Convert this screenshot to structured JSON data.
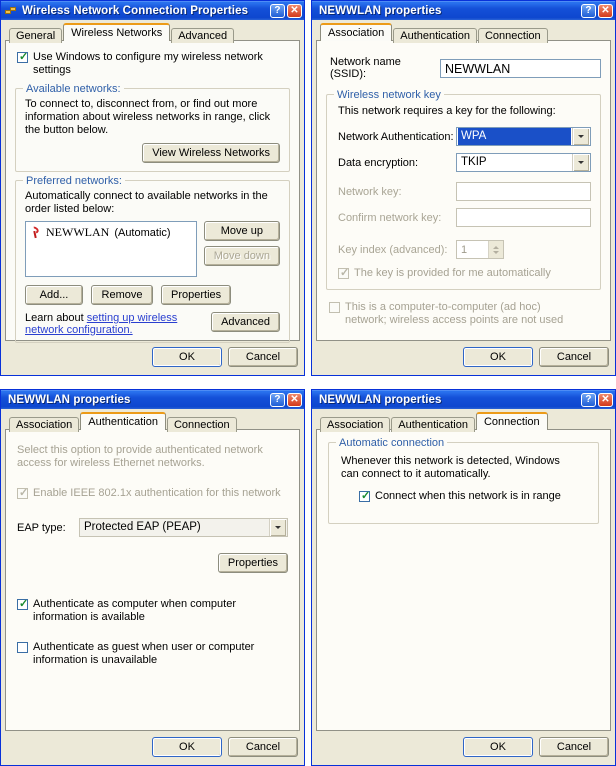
{
  "windows": {
    "wncp": {
      "title": "Wireless Network Connection Properties",
      "help_label": "?",
      "close_label": "✕",
      "tabs": [
        {
          "label": "General",
          "active": false
        },
        {
          "label": "Wireless Networks",
          "active": true
        },
        {
          "label": "Advanced",
          "active": false
        }
      ],
      "use_windows_checkbox": "Use Windows to configure my wireless network settings",
      "available_group": {
        "legend": "Available networks:",
        "description": "To connect to, disconnect from, or find out more information about wireless networks in range, click the button below.",
        "view_button": "View Wireless Networks"
      },
      "preferred_group": {
        "legend": "Preferred networks:",
        "description": "Automatically connect to available networks in the order listed below:",
        "list": [
          {
            "name": "NEWWLAN",
            "mode": "(Automatic)",
            "icon": "wireless-signal-icon"
          }
        ],
        "move_up": "Move up",
        "move_down": "Move down",
        "add": "Add...",
        "remove": "Remove",
        "properties": "Properties",
        "learn_prefix": "Learn about ",
        "learn_link": "setting up wireless network configuration.",
        "advanced": "Advanced"
      },
      "ok": "OK",
      "cancel": "Cancel"
    },
    "assoc": {
      "title": "NEWWLAN properties",
      "help_label": "?",
      "close_label": "✕",
      "tabs": [
        {
          "label": "Association",
          "active": true
        },
        {
          "label": "Authentication",
          "active": false
        },
        {
          "label": "Connection",
          "active": false
        }
      ],
      "ssid_label": "Network name (SSID):",
      "ssid_value": "NEWWLAN",
      "key_group": {
        "legend": "Wireless network key",
        "description": "This network requires a key for the following:",
        "auth_label": "Network Authentication:",
        "auth_value": "WPA",
        "enc_label": "Data encryption:",
        "enc_value": "TKIP",
        "netkey_label": "Network key:",
        "netkey_value": "",
        "confirm_label": "Confirm network key:",
        "confirm_value": "",
        "keyindex_label": "Key index (advanced):",
        "keyindex_value": "1",
        "auto_key_checkbox": "The key is provided for me automatically"
      },
      "adhoc_checkbox": "This is a computer-to-computer (ad hoc) network; wireless access points are not used",
      "ok": "OK",
      "cancel": "Cancel"
    },
    "auth": {
      "title": "NEWWLAN properties",
      "help_label": "?",
      "close_label": "✕",
      "tabs": [
        {
          "label": "Association",
          "active": false
        },
        {
          "label": "Authentication",
          "active": true
        },
        {
          "label": "Connection",
          "active": false
        }
      ],
      "description": "Select this option to provide authenticated network access for wireless Ethernet networks.",
      "enable_8021x_checkbox": "Enable IEEE 802.1x authentication for this network",
      "eap_label": "EAP type:",
      "eap_value": "Protected EAP (PEAP)",
      "properties": "Properties",
      "auth_computer_checkbox": "Authenticate as computer when computer information is available",
      "auth_guest_checkbox": "Authenticate as guest when user or computer information is unavailable",
      "ok": "OK",
      "cancel": "Cancel"
    },
    "conn": {
      "title": "NEWWLAN properties",
      "help_label": "?",
      "close_label": "✕",
      "tabs": [
        {
          "label": "Association",
          "active": false
        },
        {
          "label": "Authentication",
          "active": false
        },
        {
          "label": "Connection",
          "active": true
        }
      ],
      "group": {
        "legend": "Automatic connection",
        "description": "Whenever this network is detected, Windows can connect to it automatically.",
        "connect_checkbox": "Connect when this network is in range"
      },
      "ok": "OK",
      "cancel": "Cancel"
    }
  },
  "colors": {
    "titlebar_blue": "#0e47cf",
    "dialog_face": "#ece9d8",
    "tab_page": "#fbfbf7",
    "active_tab_accent": "#ec9b18",
    "group_legend": "#2f5fa8",
    "link": "#2a3fd0",
    "selected_combo": "#1a50c8",
    "check_green": "#1a8a2f",
    "close_red": "#d2391b"
  }
}
